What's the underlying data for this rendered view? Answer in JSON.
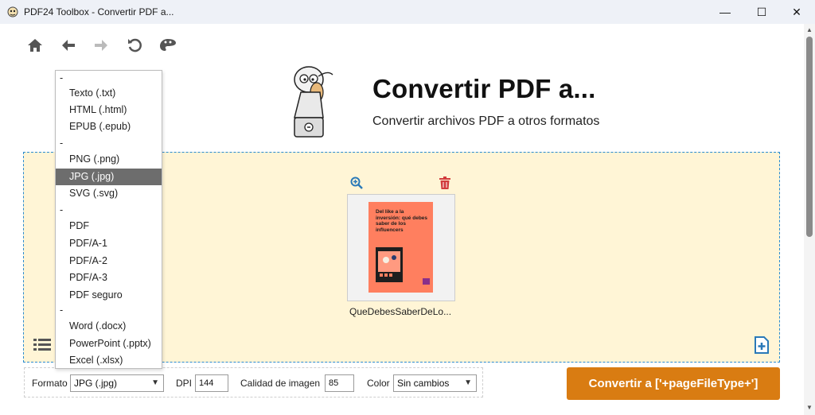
{
  "window": {
    "title": "PDF24 Toolbox - Convertir PDF a...",
    "minimize_glyph": "—",
    "maximize_glyph": "☐",
    "close_glyph": "✕"
  },
  "toolbar": {
    "icons": [
      "home-icon",
      "back-arrow-icon",
      "forward-arrow-icon",
      "reload-icon",
      "theme-palette-icon"
    ]
  },
  "header": {
    "title": "Convertir PDF a...",
    "subtitle": "Convertir archivos PDF a otros formatos"
  },
  "file": {
    "name": "QueDebesSaberDeLo...",
    "thumbnail_title": "Del like a la inversión: qué debes saber de los influencers"
  },
  "format_menu": {
    "groups": [
      {
        "separator": "-",
        "items": [
          "Texto (.txt)",
          "HTML (.html)",
          "EPUB (.epub)"
        ]
      },
      {
        "separator": "-",
        "items": [
          "PNG (.png)",
          "JPG (.jpg)",
          "SVG (.svg)"
        ]
      },
      {
        "separator": "-",
        "items": [
          "PDF",
          "PDF/A-1",
          "PDF/A-2",
          "PDF/A-3",
          "PDF seguro"
        ]
      },
      {
        "separator": "-",
        "items": [
          "Word (.docx)",
          "PowerPoint (.pptx)",
          "Excel (.xlsx)"
        ]
      }
    ],
    "selected": "JPG (.jpg)"
  },
  "options": {
    "format_label": "Formato",
    "format_value": "JPG (.jpg)",
    "dpi_label": "DPI",
    "dpi_value": "144",
    "quality_label": "Calidad de imagen",
    "quality_value": "85",
    "color_label": "Color",
    "color_value": "Sin cambios"
  },
  "convert_button": "Convertir a ['+pageFileType+']",
  "colors": {
    "accent": "#d97c12",
    "dropzone_bg": "#fff5d6",
    "dropzone_border": "#2a8bd0",
    "icon_blue": "#2a79b8",
    "icon_red": "#d23c3c"
  }
}
